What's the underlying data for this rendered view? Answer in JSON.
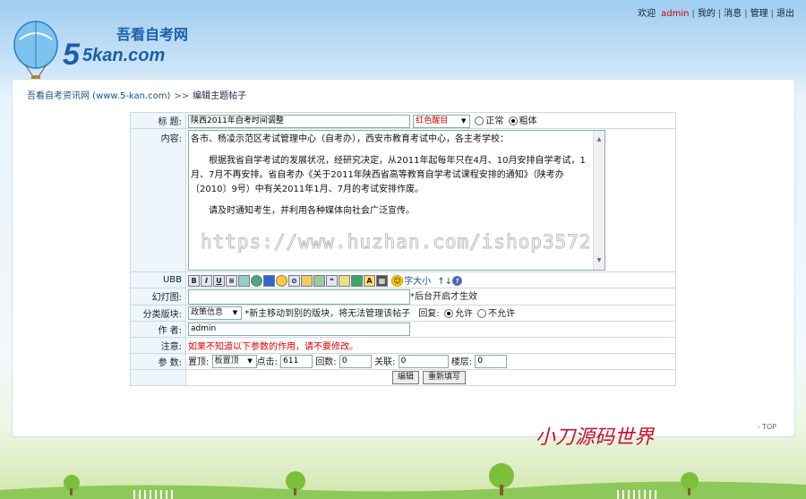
{
  "topnav": {
    "welcome": "欢迎",
    "user": "admin",
    "mine": "我的",
    "messages": "消息",
    "manage": "管理",
    "logout": "退出"
  },
  "logo": {
    "text": "吾看自考网",
    "domain": "5kan.com"
  },
  "breadcrumb": {
    "site": "吾看自考资讯网 (www.5-kan.com)",
    "separator": ">>",
    "page": "编辑主题帖子"
  },
  "form": {
    "title_label": "标 题:",
    "title_value": "陕西2011年自考时间调整",
    "color_select": "红色醒目",
    "style_normal": "正常",
    "style_bold": "粗体",
    "content_label": "内容:",
    "content": [
      "各市、杨凌示范区考试管理中心（自考办），西安市教育考试中心，各主考学校：",
      "　　根据我省自学考试的发展状况，经研究决定，从2011年起每年只在4月、10月安排自学考试，1月、7月不再安排。省自考办《关于2011年陕西省高等教育自学考试课程安排的通知》（陕考办〔2010〕9号）中有关2011年1月、7月的考试安排作废。",
      "　　请及时通知考生，并利用各种媒体向社会广泛宣传。"
    ],
    "ubb_label": "UBB",
    "ubb_fontsize": "字大小",
    "slide_label": "幻灯图:",
    "slide_note": "*后台开启才生效",
    "category_label": "分类版块:",
    "category_value": "政策信息",
    "category_note": "*新主移动到别的版块，将无法管理该帖子",
    "reply_label": "回复:",
    "reply_allow": "允许",
    "reply_deny": "不允许",
    "author_label": "作 者:",
    "author_value": "admin",
    "notice_label": "注意:",
    "notice_text": "如果不知道以下参数的作用，请不要修改。",
    "params_label": "参 数:",
    "sticky_label": "置顶:",
    "sticky_value": "板置顶",
    "clicks_label": "点击:",
    "clicks_value": "611",
    "replies_label": "回数:",
    "replies_value": "0",
    "related_label": "关联:",
    "related_value": "0",
    "floor_label": "楼层:",
    "floor_value": "0",
    "submit": "编辑",
    "reset": "重新填写"
  },
  "watermark": "https://www.huzhan.com/ishop3572",
  "top_link": "- TOP",
  "signature": "小刀源码世界"
}
